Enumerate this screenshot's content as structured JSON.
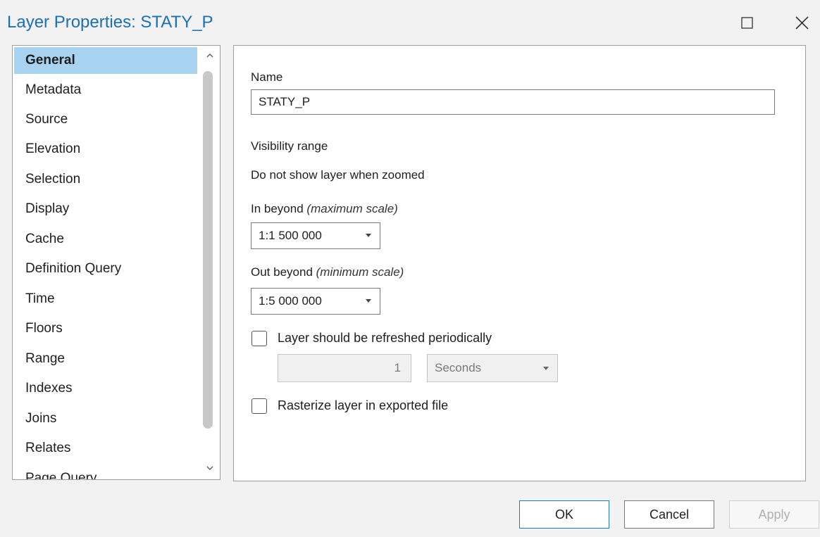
{
  "window": {
    "title": "Layer Properties: STATY_P",
    "maximize_icon": "maximize-icon",
    "close_icon": "close-icon"
  },
  "nav": {
    "items": [
      {
        "label": "General",
        "selected": true
      },
      {
        "label": "Metadata"
      },
      {
        "label": "Source"
      },
      {
        "label": "Elevation"
      },
      {
        "label": "Selection"
      },
      {
        "label": "Display"
      },
      {
        "label": "Cache"
      },
      {
        "label": "Definition Query"
      },
      {
        "label": "Time"
      },
      {
        "label": "Floors"
      },
      {
        "label": "Range"
      },
      {
        "label": "Indexes"
      },
      {
        "label": "Joins"
      },
      {
        "label": "Relates"
      },
      {
        "label": "Page Query"
      }
    ]
  },
  "general": {
    "name_label": "Name",
    "name_value": "STATY_P",
    "visibility_heading": "Visibility range",
    "zoom_text": "Do not show layer when zoomed",
    "in_beyond_label": "In beyond",
    "in_beyond_hint": "(maximum scale)",
    "in_beyond_value": "1:1 500 000",
    "out_beyond_label": "Out beyond",
    "out_beyond_hint": "(minimum scale)",
    "out_beyond_value": "1:5 000 000",
    "refresh_label": "Layer should be refreshed periodically",
    "refresh_interval": "1",
    "refresh_unit": "Seconds",
    "rasterize_label": "Rasterize layer in exported file"
  },
  "footer": {
    "ok_label": "OK",
    "cancel_label": "Cancel",
    "apply_label": "Apply"
  },
  "colors": {
    "accent": "#1c6fb5",
    "selection": "#a9d4f1"
  }
}
